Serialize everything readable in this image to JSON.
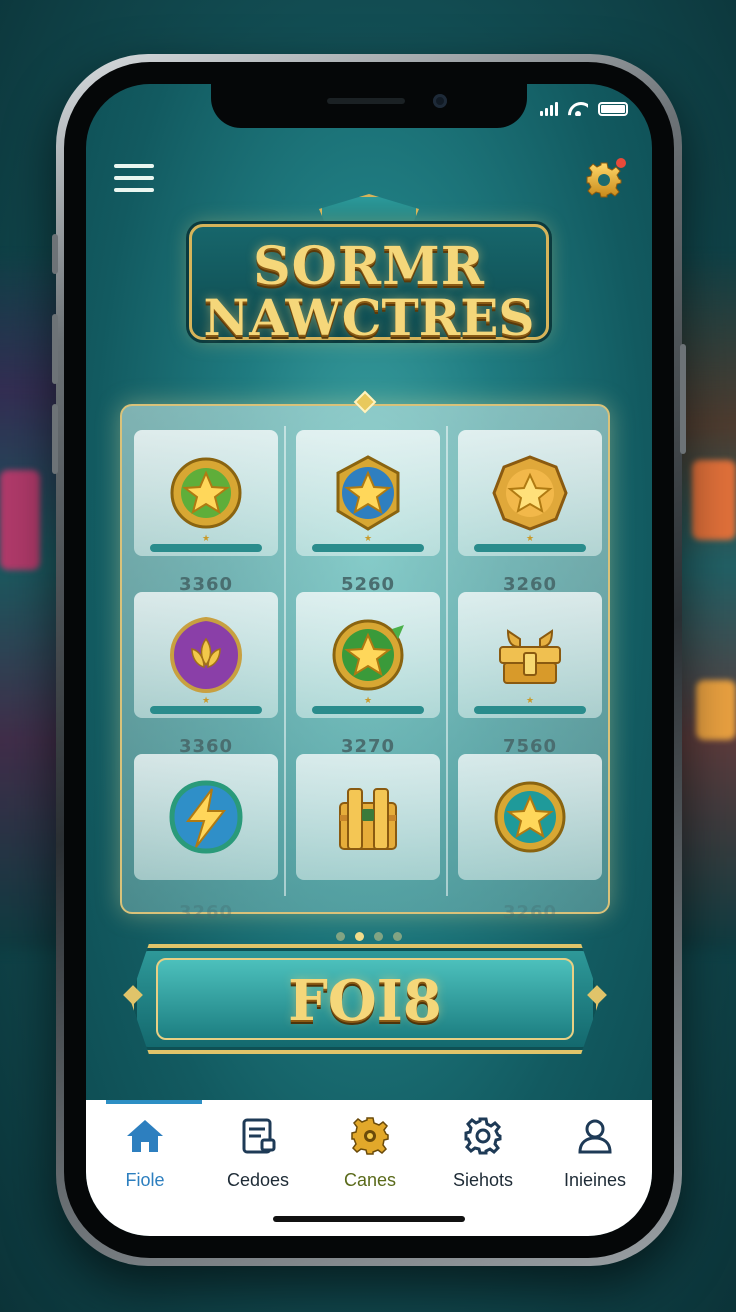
{
  "status_bar": {
    "signal_icon": "signal-bars-icon",
    "wifi_icon": "wifi-icon",
    "battery_icon": "battery-icon"
  },
  "header": {
    "menu_icon": "hamburger-menu-icon",
    "settings_icon": "gear-icon",
    "settings_notification": true
  },
  "logo": {
    "line1": "SORMR",
    "line2": "NAWCTRES"
  },
  "grid": {
    "items": [
      {
        "icon": "green-star-badge-icon",
        "score": "3360"
      },
      {
        "icon": "blue-star-badge-icon",
        "score": "5260"
      },
      {
        "icon": "gold-star-badge-icon",
        "score": "3260"
      },
      {
        "icon": "purple-lotus-badge-icon",
        "score": "3360"
      },
      {
        "icon": "green-star-coin-icon",
        "score": "3270"
      },
      {
        "icon": "gold-treasure-chest-icon",
        "score": "7560"
      },
      {
        "icon": "lightning-badge-icon",
        "score": "3260"
      },
      {
        "icon": "gold-chest-icon",
        "score": ""
      },
      {
        "icon": "teal-star-coin-icon",
        "score": "3260"
      }
    ],
    "pager_active": 1,
    "pager_count": 4
  },
  "main_button": {
    "label": "FOI8"
  },
  "page_indicator": {
    "active": 0,
    "count": 3
  },
  "tab_bar": {
    "tabs": [
      {
        "label": "Fiole",
        "icon": "home-icon",
        "active": true
      },
      {
        "label": "Cedoes",
        "icon": "document-list-icon",
        "active": false
      },
      {
        "label": "Canes",
        "icon": "gold-gear-icon",
        "active": false
      },
      {
        "label": "Siehots",
        "icon": "settings-gear-icon",
        "active": false
      },
      {
        "label": "Inieines",
        "icon": "user-profile-icon",
        "active": false
      }
    ]
  },
  "colors": {
    "gold": "#f5d77a",
    "teal": "#1f7b80",
    "active_tab": "#2d7fbf",
    "canes_tab": "#5a6a1a"
  }
}
